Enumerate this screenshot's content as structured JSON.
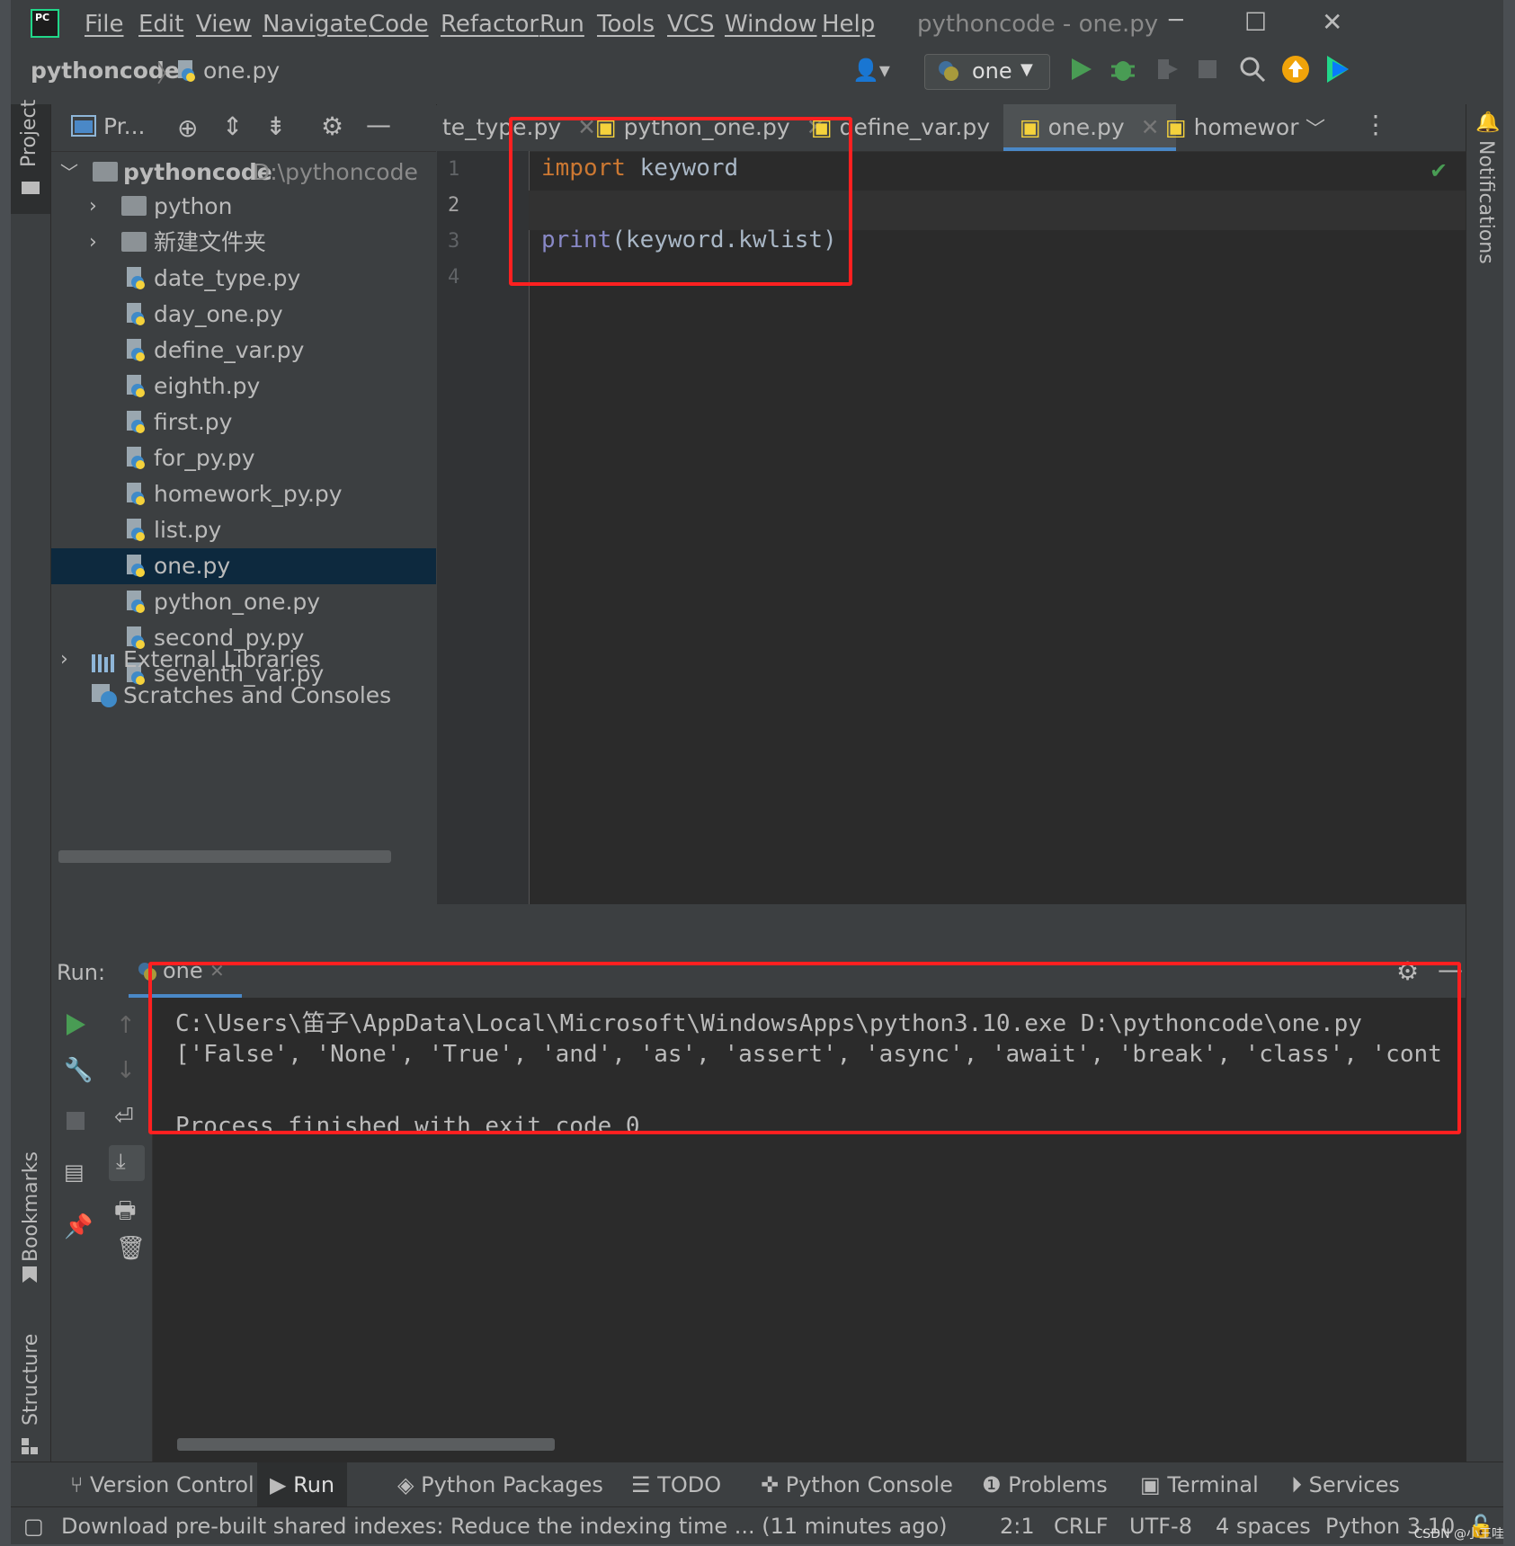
{
  "window": {
    "app_logo": "PC",
    "title": "pythoncode - one.py",
    "menu": [
      "File",
      "Edit",
      "View",
      "Navigate",
      "Code",
      "Refactor",
      "Run",
      "Tools",
      "VCS",
      "Window",
      "Help"
    ],
    "controls": {
      "minimize": "─",
      "maximize": "☐",
      "close": "✕"
    }
  },
  "navbar": {
    "project": "pythoncode",
    "file": "one.py",
    "run_config": "one"
  },
  "left_strip": {
    "project": "Project",
    "bookmarks": "Bookmarks",
    "structure": "Structure"
  },
  "right_strip": {
    "notifications": "Notifications"
  },
  "project_panel": {
    "title": "Pr...",
    "root": {
      "name": "pythoncode",
      "path": "D:\\pythoncode"
    },
    "folders": [
      "python",
      "新建文件夹"
    ],
    "files": [
      "date_type.py",
      "day_one.py",
      "define_var.py",
      "eighth.py",
      "first.py",
      "for_py.py",
      "homework_py.py",
      "list.py",
      "one.py",
      "python_one.py",
      "second_py.py",
      "seventh_var.py"
    ],
    "selected_file": "one.py",
    "external_libraries": "External Libraries",
    "scratches": "Scratches and Consoles"
  },
  "editor": {
    "tabs": [
      {
        "label": "te_type.py",
        "active": false
      },
      {
        "label": "python_one.py",
        "active": false
      },
      {
        "label": "define_var.py",
        "active": false
      },
      {
        "label": "one.py",
        "active": true
      },
      {
        "label": "homeworl",
        "active": false
      }
    ],
    "line_numbers": [
      "1",
      "2",
      "3",
      "4"
    ],
    "code": {
      "line1_keyword": "import",
      "line1_rest": " keyword",
      "line3_builtin": "print",
      "line3_rest": "(keyword.kwlist)"
    }
  },
  "run_panel": {
    "label": "Run:",
    "tab": "one",
    "output": [
      "C:\\Users\\笛子\\AppData\\Local\\Microsoft\\WindowsApps\\python3.10.exe D:\\pythoncode\\one.py",
      "['False', 'None', 'True', 'and', 'as', 'assert', 'async', 'await', 'break', 'class', 'cont",
      "",
      "Process finished with exit code 0"
    ]
  },
  "bottom_tools": [
    "Version Control",
    "Run",
    "Python Packages",
    "TODO",
    "Python Console",
    "Problems",
    "Terminal",
    "Services"
  ],
  "status_bar": {
    "message": "Download pre-built shared indexes: Reduce the indexing time ... (11 minutes ago)",
    "position": "2:1",
    "line_sep": "CRLF",
    "encoding": "UTF-8",
    "indent": "4 spaces",
    "interpreter": "Python 3.10"
  },
  "watermark": "CSDN @小王哇",
  "colors": {
    "accent": "#4a88c7",
    "highlight": "#ff2020",
    "keyword": "#cc7832",
    "builtin": "#8888c6",
    "run_green": "#499c54"
  }
}
